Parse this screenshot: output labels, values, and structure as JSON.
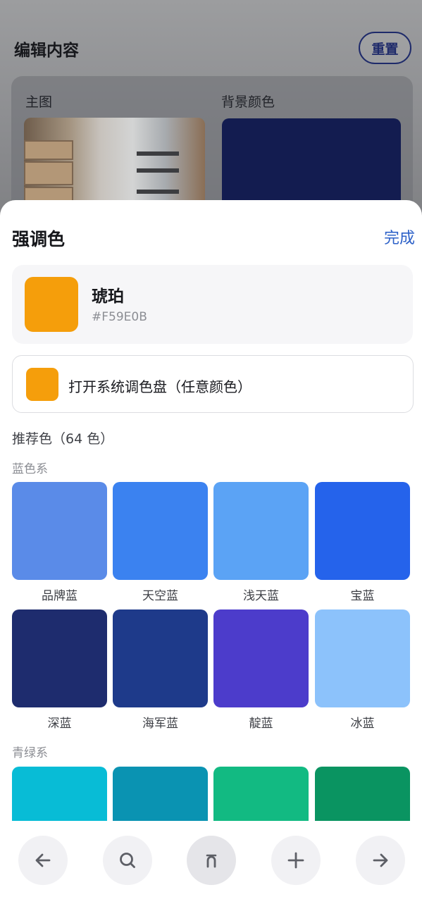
{
  "background_editor": {
    "title": "编辑内容",
    "reset_label": "重置",
    "main_image_label": "主图",
    "background_color_label": "背景颜色",
    "background_color": "#131C50"
  },
  "sheet": {
    "title": "强调色",
    "done_label": "完成",
    "current": {
      "name": "琥珀",
      "hex": "#F59E0B",
      "color": "#F59E0B"
    },
    "picker_label": "打开系统调色盘（任意颜色）",
    "recommended_label": "推荐色（64 色）",
    "groups": [
      {
        "label": "蓝色系",
        "swatches": [
          {
            "name": "品牌蓝",
            "color": "#5A8BE8"
          },
          {
            "name": "天空蓝",
            "color": "#3B82F0"
          },
          {
            "name": "浅天蓝",
            "color": "#5BA3F5"
          },
          {
            "name": "宝蓝",
            "color": "#2563EB"
          },
          {
            "name": "深蓝",
            "color": "#1E2C6E"
          },
          {
            "name": "海军蓝",
            "color": "#1E3A8A"
          },
          {
            "name": "靛蓝",
            "color": "#4C3CCB"
          },
          {
            "name": "冰蓝",
            "color": "#8CC2FB"
          }
        ]
      },
      {
        "label": "青绿系",
        "swatches": [
          {
            "color": "#08BCD6"
          },
          {
            "color": "#0A93B2"
          },
          {
            "color": "#12BA82"
          },
          {
            "color": "#0A9461"
          }
        ]
      }
    ]
  },
  "nav": [
    {
      "name": "back-arrow-icon"
    },
    {
      "name": "search-icon"
    },
    {
      "name": "home-icon"
    },
    {
      "name": "plus-icon"
    },
    {
      "name": "forward-arrow-icon"
    }
  ]
}
